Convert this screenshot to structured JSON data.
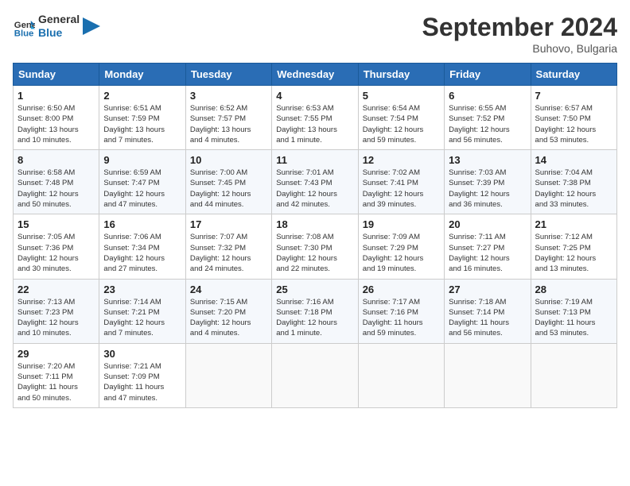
{
  "header": {
    "logo_line1": "General",
    "logo_line2": "Blue",
    "month_title": "September 2024",
    "location": "Buhovo, Bulgaria"
  },
  "weekdays": [
    "Sunday",
    "Monday",
    "Tuesday",
    "Wednesday",
    "Thursday",
    "Friday",
    "Saturday"
  ],
  "weeks": [
    [
      {
        "day": "1",
        "info": "Sunrise: 6:50 AM\nSunset: 8:00 PM\nDaylight: 13 hours\nand 10 minutes."
      },
      {
        "day": "2",
        "info": "Sunrise: 6:51 AM\nSunset: 7:59 PM\nDaylight: 13 hours\nand 7 minutes."
      },
      {
        "day": "3",
        "info": "Sunrise: 6:52 AM\nSunset: 7:57 PM\nDaylight: 13 hours\nand 4 minutes."
      },
      {
        "day": "4",
        "info": "Sunrise: 6:53 AM\nSunset: 7:55 PM\nDaylight: 13 hours\nand 1 minute."
      },
      {
        "day": "5",
        "info": "Sunrise: 6:54 AM\nSunset: 7:54 PM\nDaylight: 12 hours\nand 59 minutes."
      },
      {
        "day": "6",
        "info": "Sunrise: 6:55 AM\nSunset: 7:52 PM\nDaylight: 12 hours\nand 56 minutes."
      },
      {
        "day": "7",
        "info": "Sunrise: 6:57 AM\nSunset: 7:50 PM\nDaylight: 12 hours\nand 53 minutes."
      }
    ],
    [
      {
        "day": "8",
        "info": "Sunrise: 6:58 AM\nSunset: 7:48 PM\nDaylight: 12 hours\nand 50 minutes."
      },
      {
        "day": "9",
        "info": "Sunrise: 6:59 AM\nSunset: 7:47 PM\nDaylight: 12 hours\nand 47 minutes."
      },
      {
        "day": "10",
        "info": "Sunrise: 7:00 AM\nSunset: 7:45 PM\nDaylight: 12 hours\nand 44 minutes."
      },
      {
        "day": "11",
        "info": "Sunrise: 7:01 AM\nSunset: 7:43 PM\nDaylight: 12 hours\nand 42 minutes."
      },
      {
        "day": "12",
        "info": "Sunrise: 7:02 AM\nSunset: 7:41 PM\nDaylight: 12 hours\nand 39 minutes."
      },
      {
        "day": "13",
        "info": "Sunrise: 7:03 AM\nSunset: 7:39 PM\nDaylight: 12 hours\nand 36 minutes."
      },
      {
        "day": "14",
        "info": "Sunrise: 7:04 AM\nSunset: 7:38 PM\nDaylight: 12 hours\nand 33 minutes."
      }
    ],
    [
      {
        "day": "15",
        "info": "Sunrise: 7:05 AM\nSunset: 7:36 PM\nDaylight: 12 hours\nand 30 minutes."
      },
      {
        "day": "16",
        "info": "Sunrise: 7:06 AM\nSunset: 7:34 PM\nDaylight: 12 hours\nand 27 minutes."
      },
      {
        "day": "17",
        "info": "Sunrise: 7:07 AM\nSunset: 7:32 PM\nDaylight: 12 hours\nand 24 minutes."
      },
      {
        "day": "18",
        "info": "Sunrise: 7:08 AM\nSunset: 7:30 PM\nDaylight: 12 hours\nand 22 minutes."
      },
      {
        "day": "19",
        "info": "Sunrise: 7:09 AM\nSunset: 7:29 PM\nDaylight: 12 hours\nand 19 minutes."
      },
      {
        "day": "20",
        "info": "Sunrise: 7:11 AM\nSunset: 7:27 PM\nDaylight: 12 hours\nand 16 minutes."
      },
      {
        "day": "21",
        "info": "Sunrise: 7:12 AM\nSunset: 7:25 PM\nDaylight: 12 hours\nand 13 minutes."
      }
    ],
    [
      {
        "day": "22",
        "info": "Sunrise: 7:13 AM\nSunset: 7:23 PM\nDaylight: 12 hours\nand 10 minutes."
      },
      {
        "day": "23",
        "info": "Sunrise: 7:14 AM\nSunset: 7:21 PM\nDaylight: 12 hours\nand 7 minutes."
      },
      {
        "day": "24",
        "info": "Sunrise: 7:15 AM\nSunset: 7:20 PM\nDaylight: 12 hours\nand 4 minutes."
      },
      {
        "day": "25",
        "info": "Sunrise: 7:16 AM\nSunset: 7:18 PM\nDaylight: 12 hours\nand 1 minute."
      },
      {
        "day": "26",
        "info": "Sunrise: 7:17 AM\nSunset: 7:16 PM\nDaylight: 11 hours\nand 59 minutes."
      },
      {
        "day": "27",
        "info": "Sunrise: 7:18 AM\nSunset: 7:14 PM\nDaylight: 11 hours\nand 56 minutes."
      },
      {
        "day": "28",
        "info": "Sunrise: 7:19 AM\nSunset: 7:13 PM\nDaylight: 11 hours\nand 53 minutes."
      }
    ],
    [
      {
        "day": "29",
        "info": "Sunrise: 7:20 AM\nSunset: 7:11 PM\nDaylight: 11 hours\nand 50 minutes."
      },
      {
        "day": "30",
        "info": "Sunrise: 7:21 AM\nSunset: 7:09 PM\nDaylight: 11 hours\nand 47 minutes."
      },
      {
        "day": "",
        "info": ""
      },
      {
        "day": "",
        "info": ""
      },
      {
        "day": "",
        "info": ""
      },
      {
        "day": "",
        "info": ""
      },
      {
        "day": "",
        "info": ""
      }
    ]
  ]
}
